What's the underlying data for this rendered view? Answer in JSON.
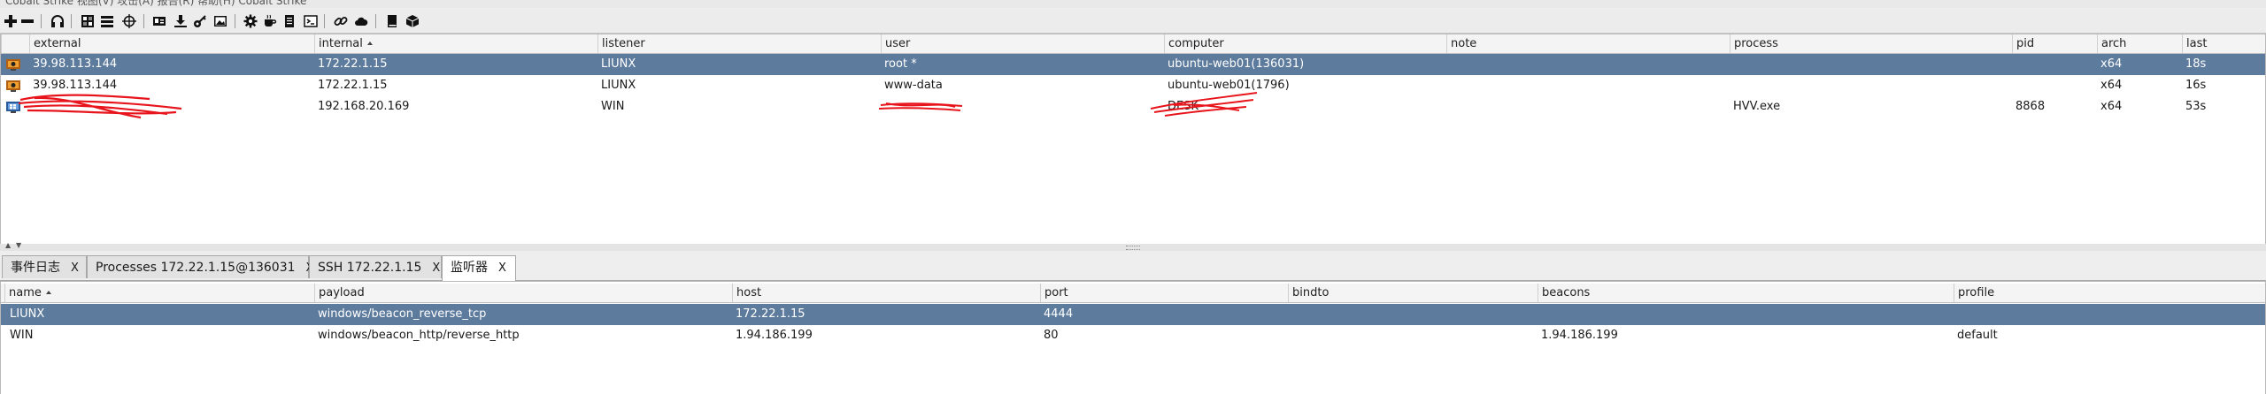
{
  "window": {
    "title": "Cobalt Strike  视图(V)  攻击(A)  报告(R)  帮助(H)  Cobalt Strike"
  },
  "toolbar": {
    "icons": [
      "plus-icon",
      "minus-icon",
      "headphones-icon",
      "grid-icon",
      "list-icon",
      "target-icon",
      "id-card-icon",
      "download-icon",
      "key-icon",
      "image-icon",
      "gear-icon",
      "coffee-icon",
      "document-icon",
      "terminal-icon",
      "link-icon",
      "cloud-icon",
      "book-icon",
      "cube-icon"
    ]
  },
  "sessions": {
    "columns": [
      "external",
      "internal",
      "listener",
      "user",
      "computer",
      "note",
      "process",
      "pid",
      "arch",
      "last"
    ],
    "sort_column": "internal",
    "rows": [
      {
        "external": "39.98.113.144",
        "internal": "172.22.1.15",
        "listener": "LIUNX",
        "user": "root *",
        "computer": "ubuntu-web01(136031)",
        "note": "",
        "process": "",
        "pid": "",
        "arch": "x64",
        "last": "18s",
        "icon": "linux-beacon-icon"
      },
      {
        "external": "39.98.113.144",
        "internal": "172.22.1.15",
        "listener": "LIUNX",
        "user": "www-data",
        "computer": "ubuntu-web01(1796)",
        "note": "",
        "process": "",
        "pid": "",
        "arch": "x64",
        "last": "16s",
        "icon": "linux-beacon-icon"
      },
      {
        "external": "",
        "internal": "192.168.20.169",
        "listener": "WIN",
        "user": "",
        "computer": "DESK",
        "note": "",
        "process": "HVV.exe",
        "pid": "8868",
        "arch": "x64",
        "last": "53s",
        "icon": "windows-beacon-icon"
      }
    ]
  },
  "tabs": [
    {
      "label": "事件日志",
      "close": "X"
    },
    {
      "label": "Processes 172.22.1.15@136031",
      "close": "X"
    },
    {
      "label": "SSH 172.22.1.15",
      "close": "X"
    },
    {
      "label": "监听器",
      "close": "X"
    }
  ],
  "listeners": {
    "columns": [
      "name",
      "payload",
      "host",
      "port",
      "bindto",
      "beacons",
      "profile"
    ],
    "sort_column": "name",
    "rows": [
      {
        "name": "LIUNX",
        "payload": "windows/beacon_reverse_tcp",
        "host": "172.22.1.15",
        "port": "4444",
        "bindto": "",
        "beacons": "",
        "profile": ""
      },
      {
        "name": "WIN",
        "payload": "windows/beacon_http/reverse_http",
        "host": "1.94.186.199",
        "port": "80",
        "bindto": "",
        "beacons": "1.94.186.199",
        "profile": "default"
      }
    ]
  },
  "colors": {
    "selected_row": "#5d7b9d",
    "redaction": "#e8141c"
  }
}
